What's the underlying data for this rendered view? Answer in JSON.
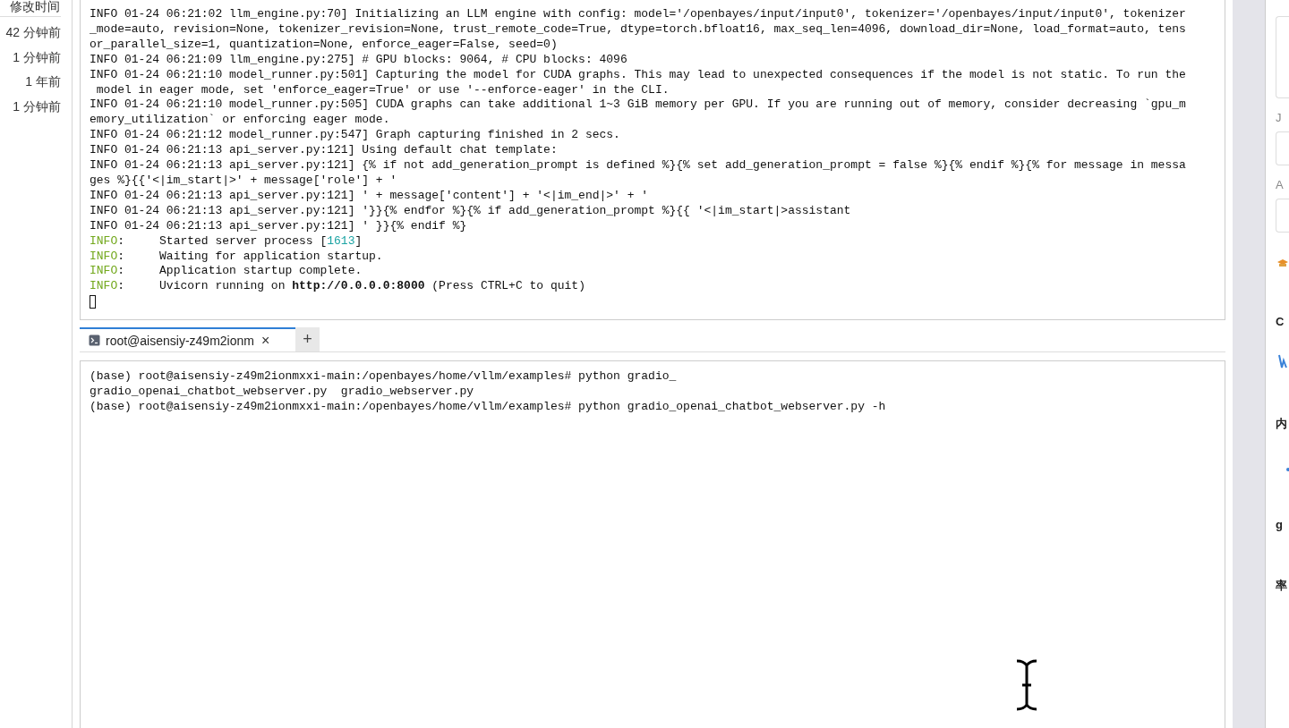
{
  "file_list": {
    "header": "修改时间",
    "times": [
      "42 分钟前",
      "1 分钟前",
      "1 年前",
      "1 分钟前"
    ]
  },
  "output_terminal": {
    "lines": [
      {
        "segments": [
          {
            "text": "INFO 01-24 06:21:02 llm_engine.py:70] Initializing an LLM engine with config: model='/openbayes/input/input0', tokenizer='/openbayes/input/input0', tokenizer",
            "kind": "plain"
          }
        ]
      },
      {
        "segments": [
          {
            "text": "_mode=auto, revision=None, tokenizer_revision=None, trust_remote_code=True, dtype=torch.bfloat16, max_seq_len=4096, download_dir=None, load_format=auto, tens",
            "kind": "plain"
          }
        ]
      },
      {
        "segments": [
          {
            "text": "or_parallel_size=1, quantization=None, enforce_eager=False, seed=0)",
            "kind": "plain"
          }
        ]
      },
      {
        "segments": [
          {
            "text": "INFO 01-24 06:21:09 llm_engine.py:275] # GPU blocks: 9064, # CPU blocks: 4096",
            "kind": "plain"
          }
        ]
      },
      {
        "segments": [
          {
            "text": "INFO 01-24 06:21:10 model_runner.py:501] Capturing the model for CUDA graphs. This may lead to unexpected consequences if the model is not static. To run the",
            "kind": "plain"
          }
        ]
      },
      {
        "segments": [
          {
            "text": " model in eager mode, set 'enforce_eager=True' or use '--enforce-eager' in the CLI.",
            "kind": "plain"
          }
        ]
      },
      {
        "segments": [
          {
            "text": "INFO 01-24 06:21:10 model_runner.py:505] CUDA graphs can take additional 1~3 GiB memory per GPU. If you are running out of memory, consider decreasing `gpu_m",
            "kind": "plain"
          }
        ]
      },
      {
        "segments": [
          {
            "text": "emory_utilization` or enforcing eager mode.",
            "kind": "plain"
          }
        ]
      },
      {
        "segments": [
          {
            "text": "INFO 01-24 06:21:12 model_runner.py:547] Graph capturing finished in 2 secs.",
            "kind": "plain"
          }
        ]
      },
      {
        "segments": [
          {
            "text": "INFO 01-24 06:21:13 api_server.py:121] Using default chat template:",
            "kind": "plain"
          }
        ]
      },
      {
        "segments": [
          {
            "text": "INFO 01-24 06:21:13 api_server.py:121] {% if not add_generation_prompt is defined %}{% set add_generation_prompt = false %}{% endif %}{% for message in messa",
            "kind": "plain"
          }
        ]
      },
      {
        "segments": [
          {
            "text": "ges %}{{'<|im_start|>' + message['role'] + '",
            "kind": "plain"
          }
        ]
      },
      {
        "segments": [
          {
            "text": "INFO 01-24 06:21:13 api_server.py:121] ' + message['content'] + '<|im_end|>' + '",
            "kind": "plain"
          }
        ]
      },
      {
        "segments": [
          {
            "text": "INFO 01-24 06:21:13 api_server.py:121] '}}{% endfor %}{% if add_generation_prompt %}{{ '<|im_start|>assistant",
            "kind": "plain"
          }
        ]
      },
      {
        "segments": [
          {
            "text": "INFO 01-24 06:21:13 api_server.py:121] ' }}{% endif %}",
            "kind": "plain"
          }
        ]
      },
      {
        "segments": [
          {
            "text": "INFO",
            "kind": "level"
          },
          {
            "text": ":     Started server process [",
            "kind": "plain"
          },
          {
            "text": "1613",
            "kind": "number"
          },
          {
            "text": "]",
            "kind": "plain"
          }
        ]
      },
      {
        "segments": [
          {
            "text": "INFO",
            "kind": "level"
          },
          {
            "text": ":     Waiting for application startup.",
            "kind": "plain"
          }
        ]
      },
      {
        "segments": [
          {
            "text": "INFO",
            "kind": "level"
          },
          {
            "text": ":     Application startup complete.",
            "kind": "plain"
          }
        ]
      },
      {
        "segments": [
          {
            "text": "INFO",
            "kind": "level"
          },
          {
            "text": ":     Uvicorn running on ",
            "kind": "plain"
          },
          {
            "text": "http://0.0.0.0:8000",
            "kind": "bold"
          },
          {
            "text": " (Press CTRL+C to quit)",
            "kind": "plain"
          }
        ]
      }
    ]
  },
  "tabs": [
    {
      "label": "root@aisensiy-z49m2ionm",
      "selected": true,
      "close": "×"
    }
  ],
  "new_tab": "+",
  "shell_terminal": {
    "lines": [
      "(base) root@aisensiy-z49m2ionmxxi-main:/openbayes/home/vllm/examples# python gradio_",
      "gradio_openai_chatbot_webserver.py  gradio_webserver.py",
      "(base) root@aisensiy-z49m2ionmxxi-main:/openbayes/home/vllm/examples# python gradio_openai_chatbot_webserver.py -h"
    ]
  },
  "side_panel": {
    "labels": [
      {
        "text": "J",
        "kind": "field-label"
      },
      {
        "text": "A",
        "kind": "field-label"
      },
      {
        "text": "C",
        "kind": "heading"
      },
      {
        "text": "内",
        "kind": "heading"
      },
      {
        "text": "g",
        "kind": "heading"
      },
      {
        "text": "率",
        "kind": "heading"
      }
    ]
  }
}
